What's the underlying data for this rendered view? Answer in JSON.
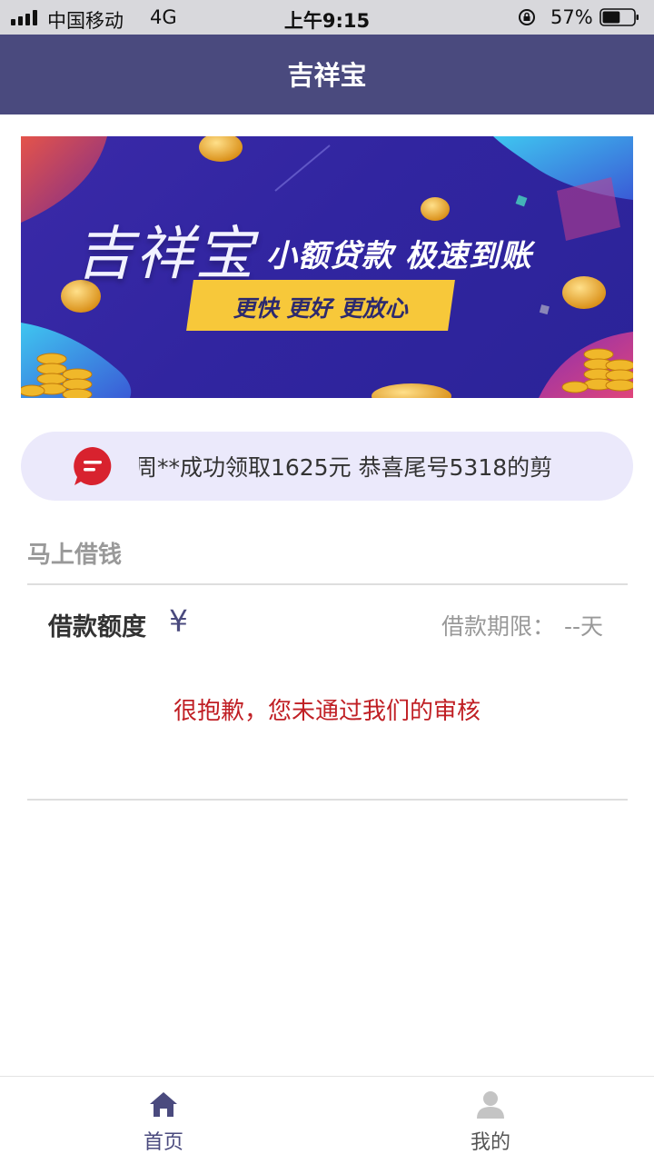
{
  "status_bar": {
    "carrier": "中国移动",
    "network": "4G",
    "time": "上午9:15",
    "battery_percent": "57%",
    "battery_level": 0.57
  },
  "nav": {
    "title": "吉祥宝"
  },
  "banner": {
    "brand": "吉祥宝",
    "slogan": "小额贷款 极速到账",
    "tagline": "更快  更好  更放心"
  },
  "notice": {
    "icon": "message-icon",
    "text": "j周**成功领取1625元 恭喜尾号5318的剪"
  },
  "loan": {
    "section_title": "马上借钱",
    "amount_label": "借款额度",
    "currency_symbol": "¥",
    "term_label": "借款期限：",
    "term_value": "--天",
    "reject_message": "很抱歉，您未通过我们的审核"
  },
  "tabs": [
    {
      "label": "首页",
      "icon": "home-icon",
      "active": true
    },
    {
      "label": "我的",
      "icon": "user-icon",
      "active": false
    }
  ],
  "colors": {
    "brand": "#4a4a7e",
    "alert": "#c01f24",
    "notice_bg": "#ebe9fb"
  }
}
